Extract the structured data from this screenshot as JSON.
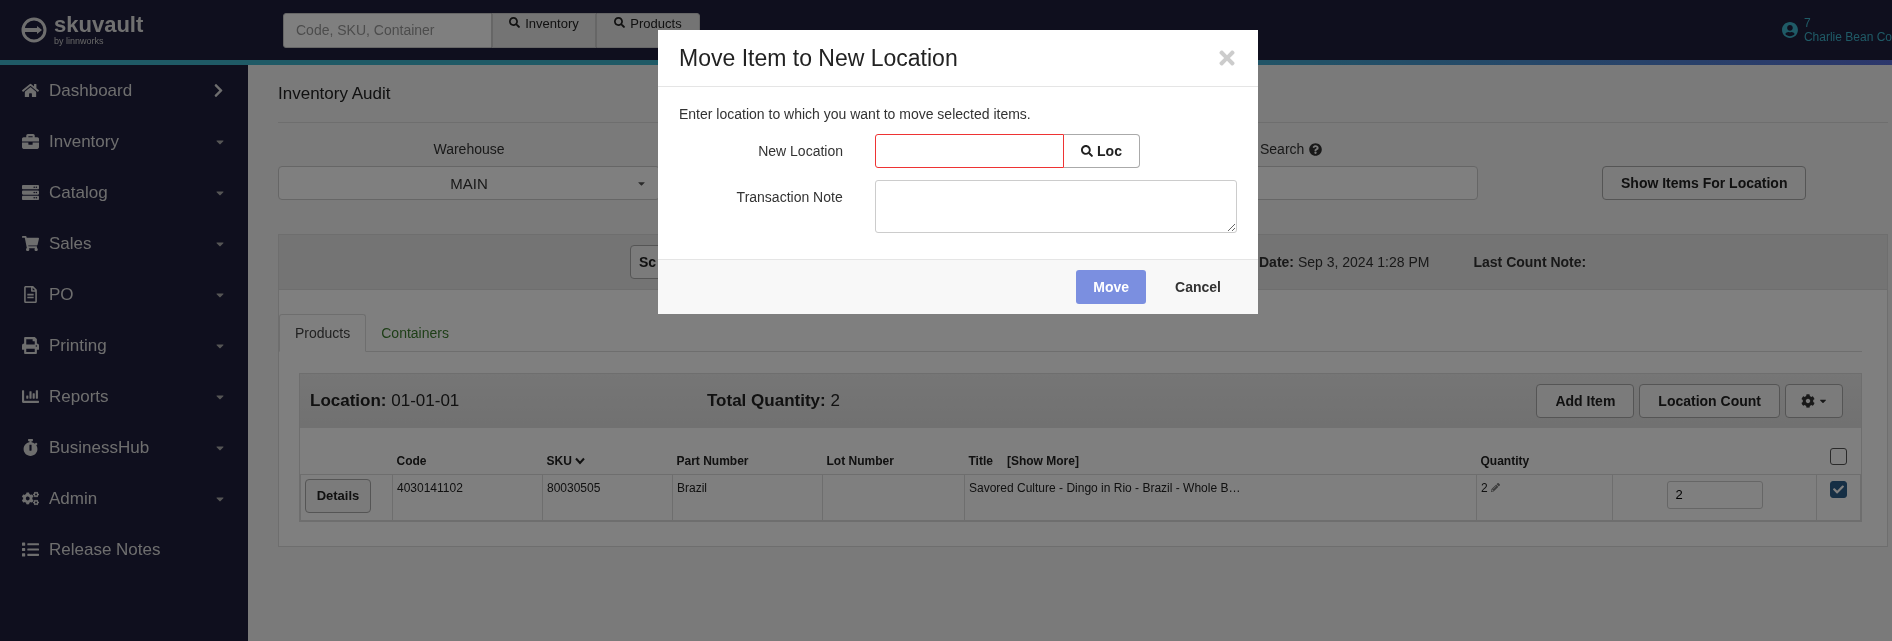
{
  "topbar": {
    "logo": "skuvault",
    "logo_sub": "by linnworks",
    "search": {
      "placeholder": "Code, SKU, Container"
    },
    "search_buttons": [
      "Inventory",
      "Products"
    ],
    "user": {
      "count": "7",
      "name": "Charlie Bean Co"
    }
  },
  "sidebar": {
    "items": [
      {
        "label": "Dashboard",
        "kind": "link"
      },
      {
        "label": "Inventory",
        "kind": "menu"
      },
      {
        "label": "Catalog",
        "kind": "menu"
      },
      {
        "label": "Sales",
        "kind": "menu"
      },
      {
        "label": "PO",
        "kind": "menu"
      },
      {
        "label": "Printing",
        "kind": "menu"
      },
      {
        "label": "Reports",
        "kind": "menu"
      },
      {
        "label": "BusinessHub",
        "kind": "menu"
      },
      {
        "label": "Admin",
        "kind": "menu"
      },
      {
        "label": "Release Notes",
        "kind": "plain"
      }
    ]
  },
  "page": {
    "title": "Inventory Audit",
    "warehouse": {
      "label": "Warehouse",
      "value": "MAIN"
    },
    "search": {
      "label": "Search"
    },
    "show_button": "Show Items For Location"
  },
  "info_bar": {
    "button": "Sc",
    "fields": [
      {
        "label": "Date:",
        "value": "Sep 3, 2024 1:28 PM"
      },
      {
        "label": "Last Count Note:"
      }
    ]
  },
  "tabs": [
    {
      "label": "Products",
      "selected": true
    },
    {
      "label": "Containers",
      "selected": false
    }
  ],
  "location_panel": {
    "location_label": "Location:",
    "location": "01-01-01",
    "total_label": "Total Quantity:",
    "total": "2",
    "buttons": [
      "Add Item",
      "Location Count"
    ]
  },
  "table": {
    "columns": [
      {
        "label": "Code",
        "sorted": false
      },
      {
        "label": "SKU",
        "sorted": true
      },
      {
        "label": "Part Number",
        "sorted": false
      },
      {
        "label": "Lot Number",
        "sorted": false
      },
      {
        "label": "Title",
        "sorted": false,
        "extra": "[Show More]"
      },
      {
        "label": "Quantity",
        "sorted": false
      }
    ],
    "all_checked": false,
    "rows": [
      {
        "button": "Details",
        "code": "4030141102",
        "sku": "80030505",
        "part_number": "Brazil",
        "title": "Savored Culture - Dingo in Rio - Brazil - Whole B…",
        "quantity": "2",
        "count": "2",
        "checked": true
      }
    ]
  },
  "modal": {
    "title": "Move Item to New Location",
    "message": "Enter location to which you want to move selected items.",
    "fields": [
      {
        "kind": "input",
        "label": "New Location",
        "button": "Loc"
      },
      {
        "kind": "textarea",
        "label": "Transaction Note"
      }
    ],
    "buttons": [
      {
        "label": "Move",
        "kind": "primary"
      },
      {
        "label": "Cancel",
        "kind": "link"
      }
    ]
  }
}
